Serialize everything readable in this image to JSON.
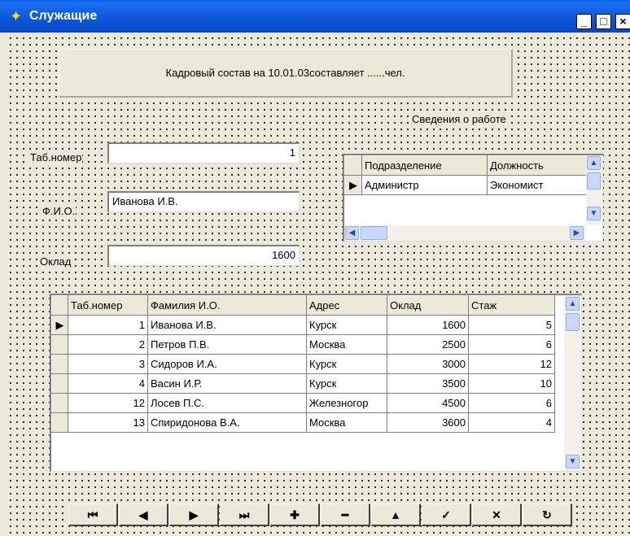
{
  "window": {
    "title": "Служащие",
    "icon": "app-icon",
    "controls": {
      "minimize": "_",
      "maximize": "□",
      "close": "×"
    }
  },
  "panel": {
    "caption": "Кадровый состав на 10.01.03составляет ......чел."
  },
  "labels": {
    "tab_number": "Таб.номер",
    "fio": "Ф.И.О.",
    "salary": "Оклад",
    "work_info": "Сведения о работе"
  },
  "fields": {
    "tab_number": "1",
    "fio": "Иванова И.В.",
    "salary": "1600"
  },
  "work_grid": {
    "columns": [
      "Подразделение",
      "Должность"
    ],
    "rows": [
      {
        "cells": [
          "Администр",
          "Экономист"
        ],
        "current": true
      }
    ]
  },
  "employees_grid": {
    "columns": [
      "Таб.номер",
      "Фамилия И.О.",
      "Адрес",
      "Оклад",
      "Стаж"
    ],
    "rows": [
      {
        "cells": [
          "1",
          "Иванова И.В.",
          "Курск",
          "1600",
          "5"
        ],
        "current": true
      },
      {
        "cells": [
          "2",
          "Петров П.В.",
          "Москва",
          "2500",
          "6"
        ]
      },
      {
        "cells": [
          "3",
          "Сидоров И.А.",
          "Курск",
          "3000",
          "12"
        ]
      },
      {
        "cells": [
          "4",
          "Васин И.Р.",
          "Курск",
          "3500",
          "10"
        ]
      },
      {
        "cells": [
          "12",
          "Лосев П.С.",
          "Железногор",
          "4500",
          "6"
        ]
      },
      {
        "cells": [
          "13",
          "Спиридонова В.А.",
          "Москва",
          "3600",
          "4"
        ]
      }
    ]
  },
  "navigator": [
    {
      "name": "first-record",
      "glyph": "⏮"
    },
    {
      "name": "prior-record",
      "glyph": "◀"
    },
    {
      "name": "next-record",
      "glyph": "▶"
    },
    {
      "name": "last-record",
      "glyph": "⏭"
    },
    {
      "name": "insert-record",
      "glyph": "✚"
    },
    {
      "name": "delete-record",
      "glyph": "━"
    },
    {
      "name": "edit-record",
      "glyph": "▲"
    },
    {
      "name": "post-edit",
      "glyph": "✓"
    },
    {
      "name": "cancel-edit",
      "glyph": "✕"
    },
    {
      "name": "refresh-data",
      "glyph": "↻"
    }
  ]
}
